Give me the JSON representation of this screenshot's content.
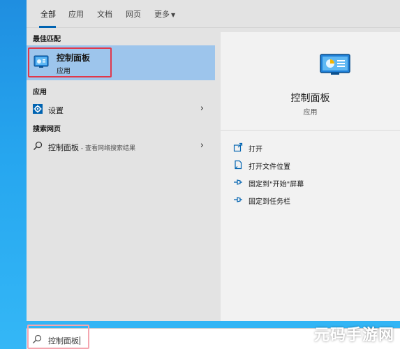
{
  "tabs": [
    {
      "label": "全部",
      "active": true
    },
    {
      "label": "应用",
      "active": false
    },
    {
      "label": "文档",
      "active": false
    },
    {
      "label": "网页",
      "active": false
    },
    {
      "label": "更多",
      "active": false
    }
  ],
  "sections": {
    "best_match": "最佳匹配",
    "apps": "应用",
    "web": "搜索网页"
  },
  "best_match": {
    "name": "控制面板",
    "type": "应用",
    "icon": "control-panel-icon"
  },
  "apps": [
    {
      "label": "设置",
      "icon": "gear-icon"
    }
  ],
  "web_results": [
    {
      "label": "控制面板",
      "sub": " - 查看网络搜索结果",
      "icon": "search-icon"
    }
  ],
  "detail": {
    "title": "控制面板",
    "subtitle": "应用",
    "actions": [
      {
        "label": "打开",
        "icon": "open-icon"
      },
      {
        "label": "打开文件位置",
        "icon": "file-location-icon"
      },
      {
        "label": "固定到\"开始\"屏幕",
        "icon": "pin-icon"
      },
      {
        "label": "固定到任务栏",
        "icon": "pin-icon"
      }
    ]
  },
  "search": {
    "value": "控制面板"
  },
  "watermark": "元码手游网",
  "colors": {
    "accent": "#0063b1",
    "selection": "#9dc5ec",
    "highlight_red": "#e0384b"
  }
}
